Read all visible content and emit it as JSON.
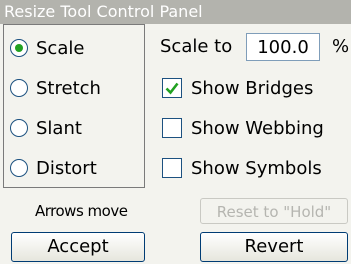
{
  "window": {
    "title": "Resize Tool Control Panel"
  },
  "modes": [
    {
      "label": "Scale",
      "selected": true
    },
    {
      "label": "Stretch",
      "selected": false
    },
    {
      "label": "Slant",
      "selected": false
    },
    {
      "label": "Distort",
      "selected": false
    }
  ],
  "scale": {
    "label": "Scale to",
    "value": "100.0",
    "unit": "%"
  },
  "options": [
    {
      "label": "Show Bridges",
      "checked": true
    },
    {
      "label": "Show Webbing",
      "checked": false
    },
    {
      "label": "Show Symbols",
      "checked": false
    }
  ],
  "hint": "Arrows move",
  "buttons": {
    "reset": "Reset to \"Hold\"",
    "accept": "Accept",
    "revert": "Revert"
  },
  "colors": {
    "titlebar": "#b3b3ad",
    "radio_selected": "#21a121",
    "check_mark": "#21a121",
    "border_blue": "#1c5180"
  }
}
